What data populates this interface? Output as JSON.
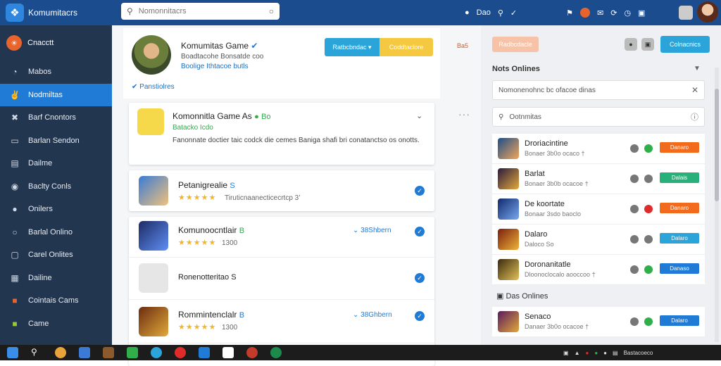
{
  "topbar": {
    "app_name": "Komumitacrs",
    "search_placeholder": "Nomonnitacrs",
    "nav_label": "Dao",
    "colors": {
      "bar": "#1b4d8e",
      "accent": "#1f7bd6"
    }
  },
  "sidebar": {
    "header": "Cnacctt",
    "items": [
      {
        "label": "Mabos",
        "icon": "gauge-icon"
      },
      {
        "label": "Nodmiltas",
        "icon": "handshake-icon",
        "active": true
      },
      {
        "label": "Barf Cnontors",
        "icon": "tools-icon"
      },
      {
        "label": "Barlan Sendon",
        "icon": "monitor-icon"
      },
      {
        "label": "Dailme",
        "icon": "list-icon"
      },
      {
        "label": "Baclty Conls",
        "icon": "gamepad-icon"
      },
      {
        "label": "Onilers",
        "icon": "user-icon"
      },
      {
        "label": "Barlal Onlino",
        "icon": "chat-icon"
      },
      {
        "label": "Carel Onlites",
        "icon": "briefcase-icon"
      },
      {
        "label": "Dailine",
        "icon": "table-icon"
      },
      {
        "label": "Cointais Cams",
        "icon": "game-art-icon"
      },
      {
        "label": "Came",
        "icon": "game-art-icon"
      }
    ]
  },
  "profile": {
    "name": "Komumitas Game",
    "sub1": "Boadtacohe Bonsatde coo",
    "sub2": "Boolige Ithtacoe butls",
    "link": "Panstiolres",
    "btn1": "Ratbcbndac ▾",
    "btn2": "Coddtaclore",
    "tag": "Ba5"
  },
  "featured": {
    "title": "Komonnitla Game As",
    "badge": "Bo",
    "sub": "Batacko Icdo",
    "desc": "Fanonnate doctier taic codck die cemes Baniga shafi bri conatanctso os onotts."
  },
  "games": [
    {
      "title": "Petanigrealie",
      "badge": "S",
      "rating_text": "★★★★★",
      "meta": "Tiruticnaanecticecrtcp 3’",
      "dl": ""
    },
    {
      "title": "Komunoocntlair",
      "badge": "B",
      "rating_text": "★★★★★",
      "meta": "1300",
      "dl": "38Shbern"
    },
    {
      "title": "Ronenotteritao",
      "badge": "S",
      "rating_text": "",
      "meta": "",
      "dl": ""
    },
    {
      "title": "Rommintenclalr",
      "badge": "B",
      "rating_text": "★★★★★",
      "meta": "1300",
      "dl": "38Ghbern"
    }
  ],
  "right": {
    "btn_orange": "Radbcdacle",
    "btn_teal": "Colnacnics",
    "heading": "Nots Onlines",
    "filter_text": "Nomonenohnc bc ofacoe dinas",
    "search_text": "Ootnmitas",
    "list": [
      {
        "name": "Droriacintine",
        "sub": "Bonaer 3b0o ocaco †",
        "status": "Danaro",
        "status_color": "#f26b1d",
        "dot": "#2fae4a"
      },
      {
        "name": "Barlat",
        "sub": "Bonaer 3b0b ocacoe †",
        "status": "Dalais",
        "status_color": "#27b07a",
        "dot": "#777"
      },
      {
        "name": "De koortate",
        "sub": "Bonaar 3sdo baoclo",
        "status": "Danaro",
        "status_color": "#f26b1d",
        "dot": "#e02b2b"
      },
      {
        "name": "Dalaro",
        "sub": "Daloco So",
        "status": "Dalaro",
        "status_color": "#2aa4d9",
        "dot": "#777"
      },
      {
        "name": "Doronanitatle",
        "sub": "Dloonoclocalo aooccoo †",
        "status": "Danaso",
        "status_color": "#1f7bd6",
        "dot": "#2fae4a"
      }
    ],
    "section2": "Das Onlines",
    "list2": [
      {
        "name": "Senaco",
        "sub": "Danaer 3b0o ocacoe †",
        "status": "Dalaro",
        "status_color": "#1f7bd6",
        "dot": "#2fae4a"
      }
    ]
  },
  "taskbar": {
    "tray_text": "Bastacoeco",
    "colors": {
      "bg": "#1c1c1c"
    }
  }
}
